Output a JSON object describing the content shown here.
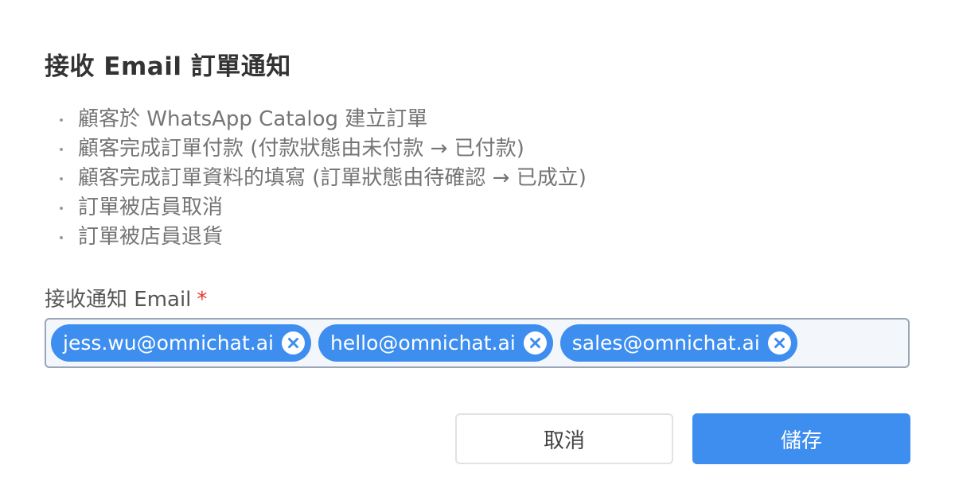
{
  "dialog": {
    "title": "接收 Email 訂單通知",
    "events": [
      "顧客於 WhatsApp Catalog 建立訂單",
      "顧客完成訂單付款 (付款狀態由未付款 → 已付款)",
      "顧客完成訂單資料的填寫 (訂單狀態由待確認 → 已成立)",
      "訂單被店員取消",
      "訂單被店員退貨"
    ],
    "email_field": {
      "label": "接收通知 Email",
      "required_mark": "*",
      "emails": [
        "jess.wu@omnichat.ai",
        "hello@omnichat.ai",
        "sales@omnichat.ai"
      ]
    },
    "buttons": {
      "cancel": "取消",
      "save": "儲存"
    }
  },
  "colors": {
    "primary": "#3e8ef0",
    "required": "#e53935",
    "title_text": "#333333",
    "list_text": "#757575",
    "input_border": "#9aa5b8",
    "input_bg": "#f3f6fb"
  },
  "icons": {
    "remove_tag": "close-circle-icon"
  }
}
